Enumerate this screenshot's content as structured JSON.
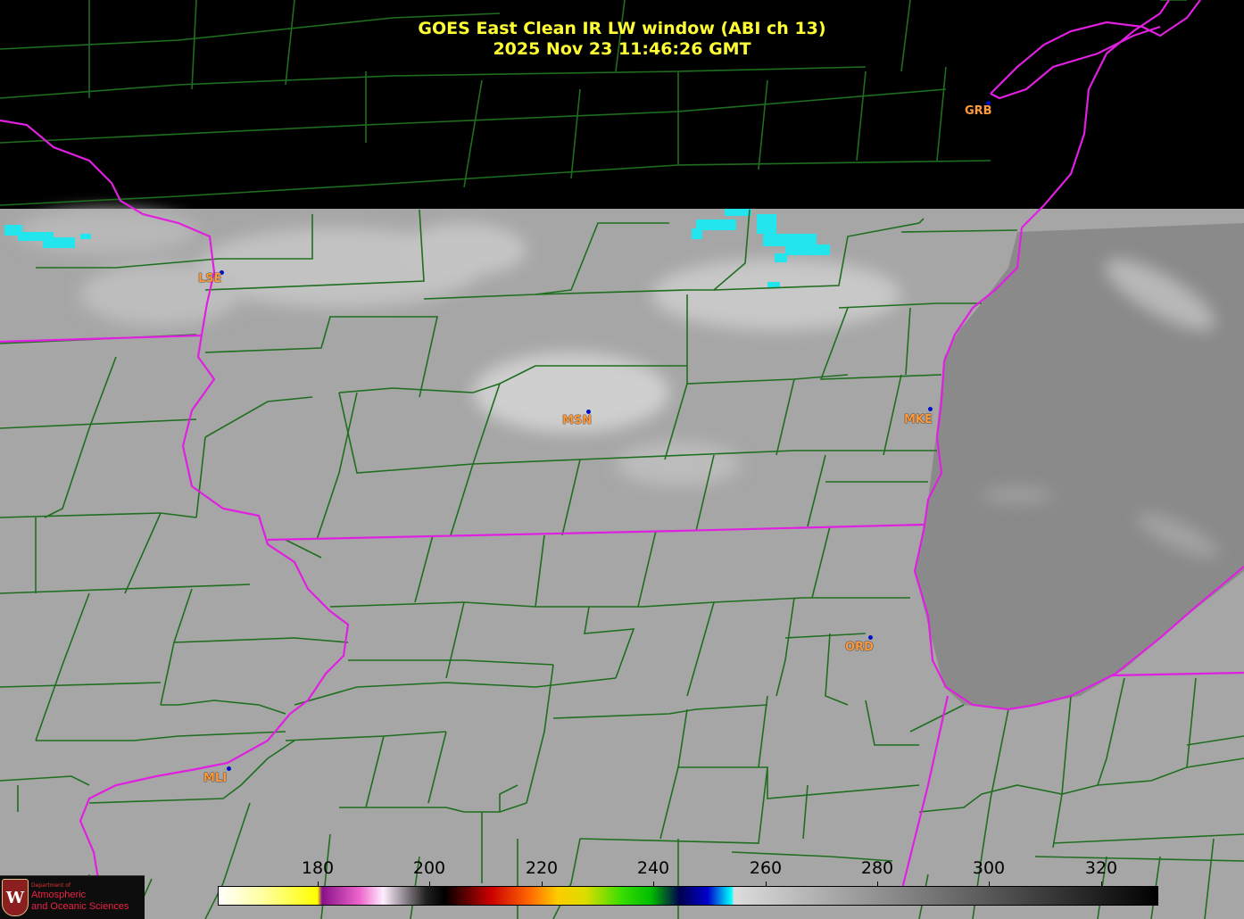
{
  "header": {
    "title_line1": "GOES East Clean IR LW window (ABI ch 13)",
    "title_line2": "2025 Nov 23  11:46:26 GMT"
  },
  "stations": [
    {
      "id": "LSE",
      "label": "LSE"
    },
    {
      "id": "GRB",
      "label": "GRB"
    },
    {
      "id": "MSN",
      "label": "MSN"
    },
    {
      "id": "MKE",
      "label": "MKE"
    },
    {
      "id": "ORD",
      "label": "ORD"
    },
    {
      "id": "MLI",
      "label": "MLI"
    }
  ],
  "colorbar": {
    "ticks": [
      "180",
      "200",
      "220",
      "240",
      "260",
      "280",
      "300",
      "320"
    ]
  },
  "logo": {
    "line_small": "Department of",
    "line1": "Atmospheric",
    "line2": "and Oceanic Sciences",
    "crest": "W"
  },
  "colors": {
    "title": "#ffff33",
    "county_lines": "#1f6e1f",
    "state_lines": "#e020e0",
    "station_label": "#ff9a3c",
    "station_dot": "#0010c8",
    "land_gray": "#a6a6a6",
    "lake_gray": "#8a8a8a",
    "cold_cloud": "#22e5ee"
  }
}
